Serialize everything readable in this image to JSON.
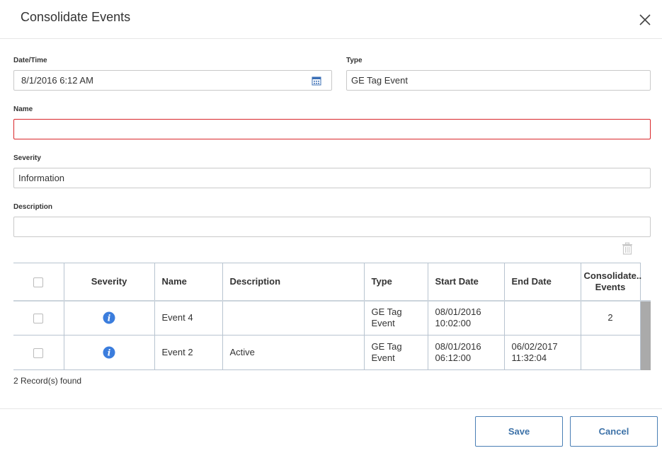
{
  "dialog": {
    "title": "Consolidate Events"
  },
  "form": {
    "datetime": {
      "label": "Date/Time",
      "value": "8/1/2016 6:12 AM"
    },
    "type": {
      "label": "Type",
      "value": "GE Tag Event"
    },
    "name": {
      "label": "Name",
      "value": ""
    },
    "severity": {
      "label": "Severity",
      "value": "Information"
    },
    "description": {
      "label": "Description",
      "value": ""
    }
  },
  "table": {
    "columns": [
      "Severity",
      "Name",
      "Description",
      "Type",
      "Start Date",
      "End Date",
      "Consolidate..",
      "Events"
    ],
    "rows": [
      {
        "severity_icon": "info-icon",
        "name": "Event 4",
        "description": "",
        "type_line1": "GE Tag",
        "type_line2": "Event",
        "start_line1": "08/01/2016",
        "start_line2": "10:02:00",
        "end_line1": "",
        "end_line2": "",
        "events": "2"
      },
      {
        "severity_icon": "info-icon",
        "name": "Event 2",
        "description": "Active",
        "type_line1": "GE Tag",
        "type_line2": "Event",
        "start_line1": "08/01/2016",
        "start_line2": "06:12:00",
        "end_line1": "06/02/2017",
        "end_line2": "11:32:04",
        "events": ""
      }
    ],
    "records_found": "2 Record(s) found"
  },
  "footer": {
    "save_label": "Save",
    "cancel_label": "Cancel"
  },
  "colors": {
    "accent": "#3d72a8",
    "invalid": "#d9262a",
    "info": "#3b7ddd"
  }
}
